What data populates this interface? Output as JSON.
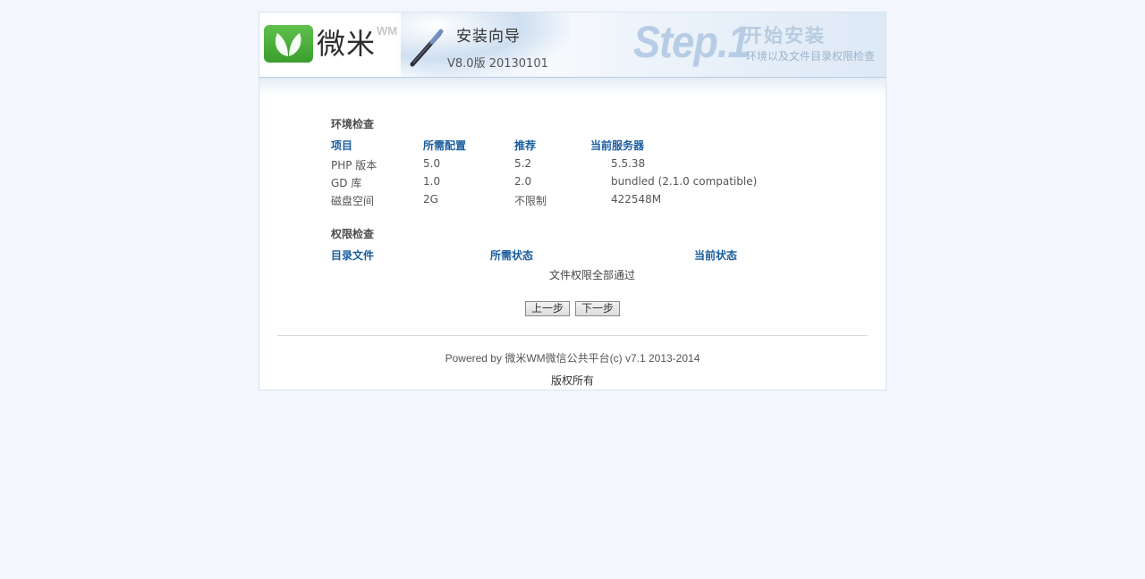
{
  "header": {
    "logo_text": "微米",
    "logo_sup": "WM",
    "wizard_title": "安装向导",
    "wizard_version": "V8.0版 20130101",
    "step_label": "Step.1",
    "step_title": "开始安装",
    "step_subtitle": "环境以及文件目录权限检查"
  },
  "env_check": {
    "title": "环境检查",
    "headers": [
      "项目",
      "所需配置",
      "推荐",
      "当前服务器"
    ],
    "rows": [
      [
        "PHP 版本",
        "5.0",
        "5.2",
        "5.5.38"
      ],
      [
        "GD 库",
        "1.0",
        "2.0",
        "bundled (2.1.0 compatible)"
      ],
      [
        "磁盘空间",
        "2G",
        "不限制",
        "422548M"
      ]
    ]
  },
  "perm_check": {
    "title": "权限检查",
    "headers": [
      "目录文件",
      "所需状态",
      "当前状态"
    ],
    "message": "文件权限全部通过"
  },
  "buttons": {
    "prev": "上一步",
    "next": "下一步"
  },
  "footer": {
    "powered": "Powered by 微米WM微信公共平台(c) v7.1 2013-2014",
    "copyright": "版权所有"
  },
  "colors": {
    "page_background": "#f3f7fd",
    "column_header": "#1a5d9e",
    "logo_green": "#4caf3a",
    "step_watermark": "#b7cde5"
  },
  "icons": [
    "leaf-logo-icon",
    "magic-wand-icon"
  ]
}
